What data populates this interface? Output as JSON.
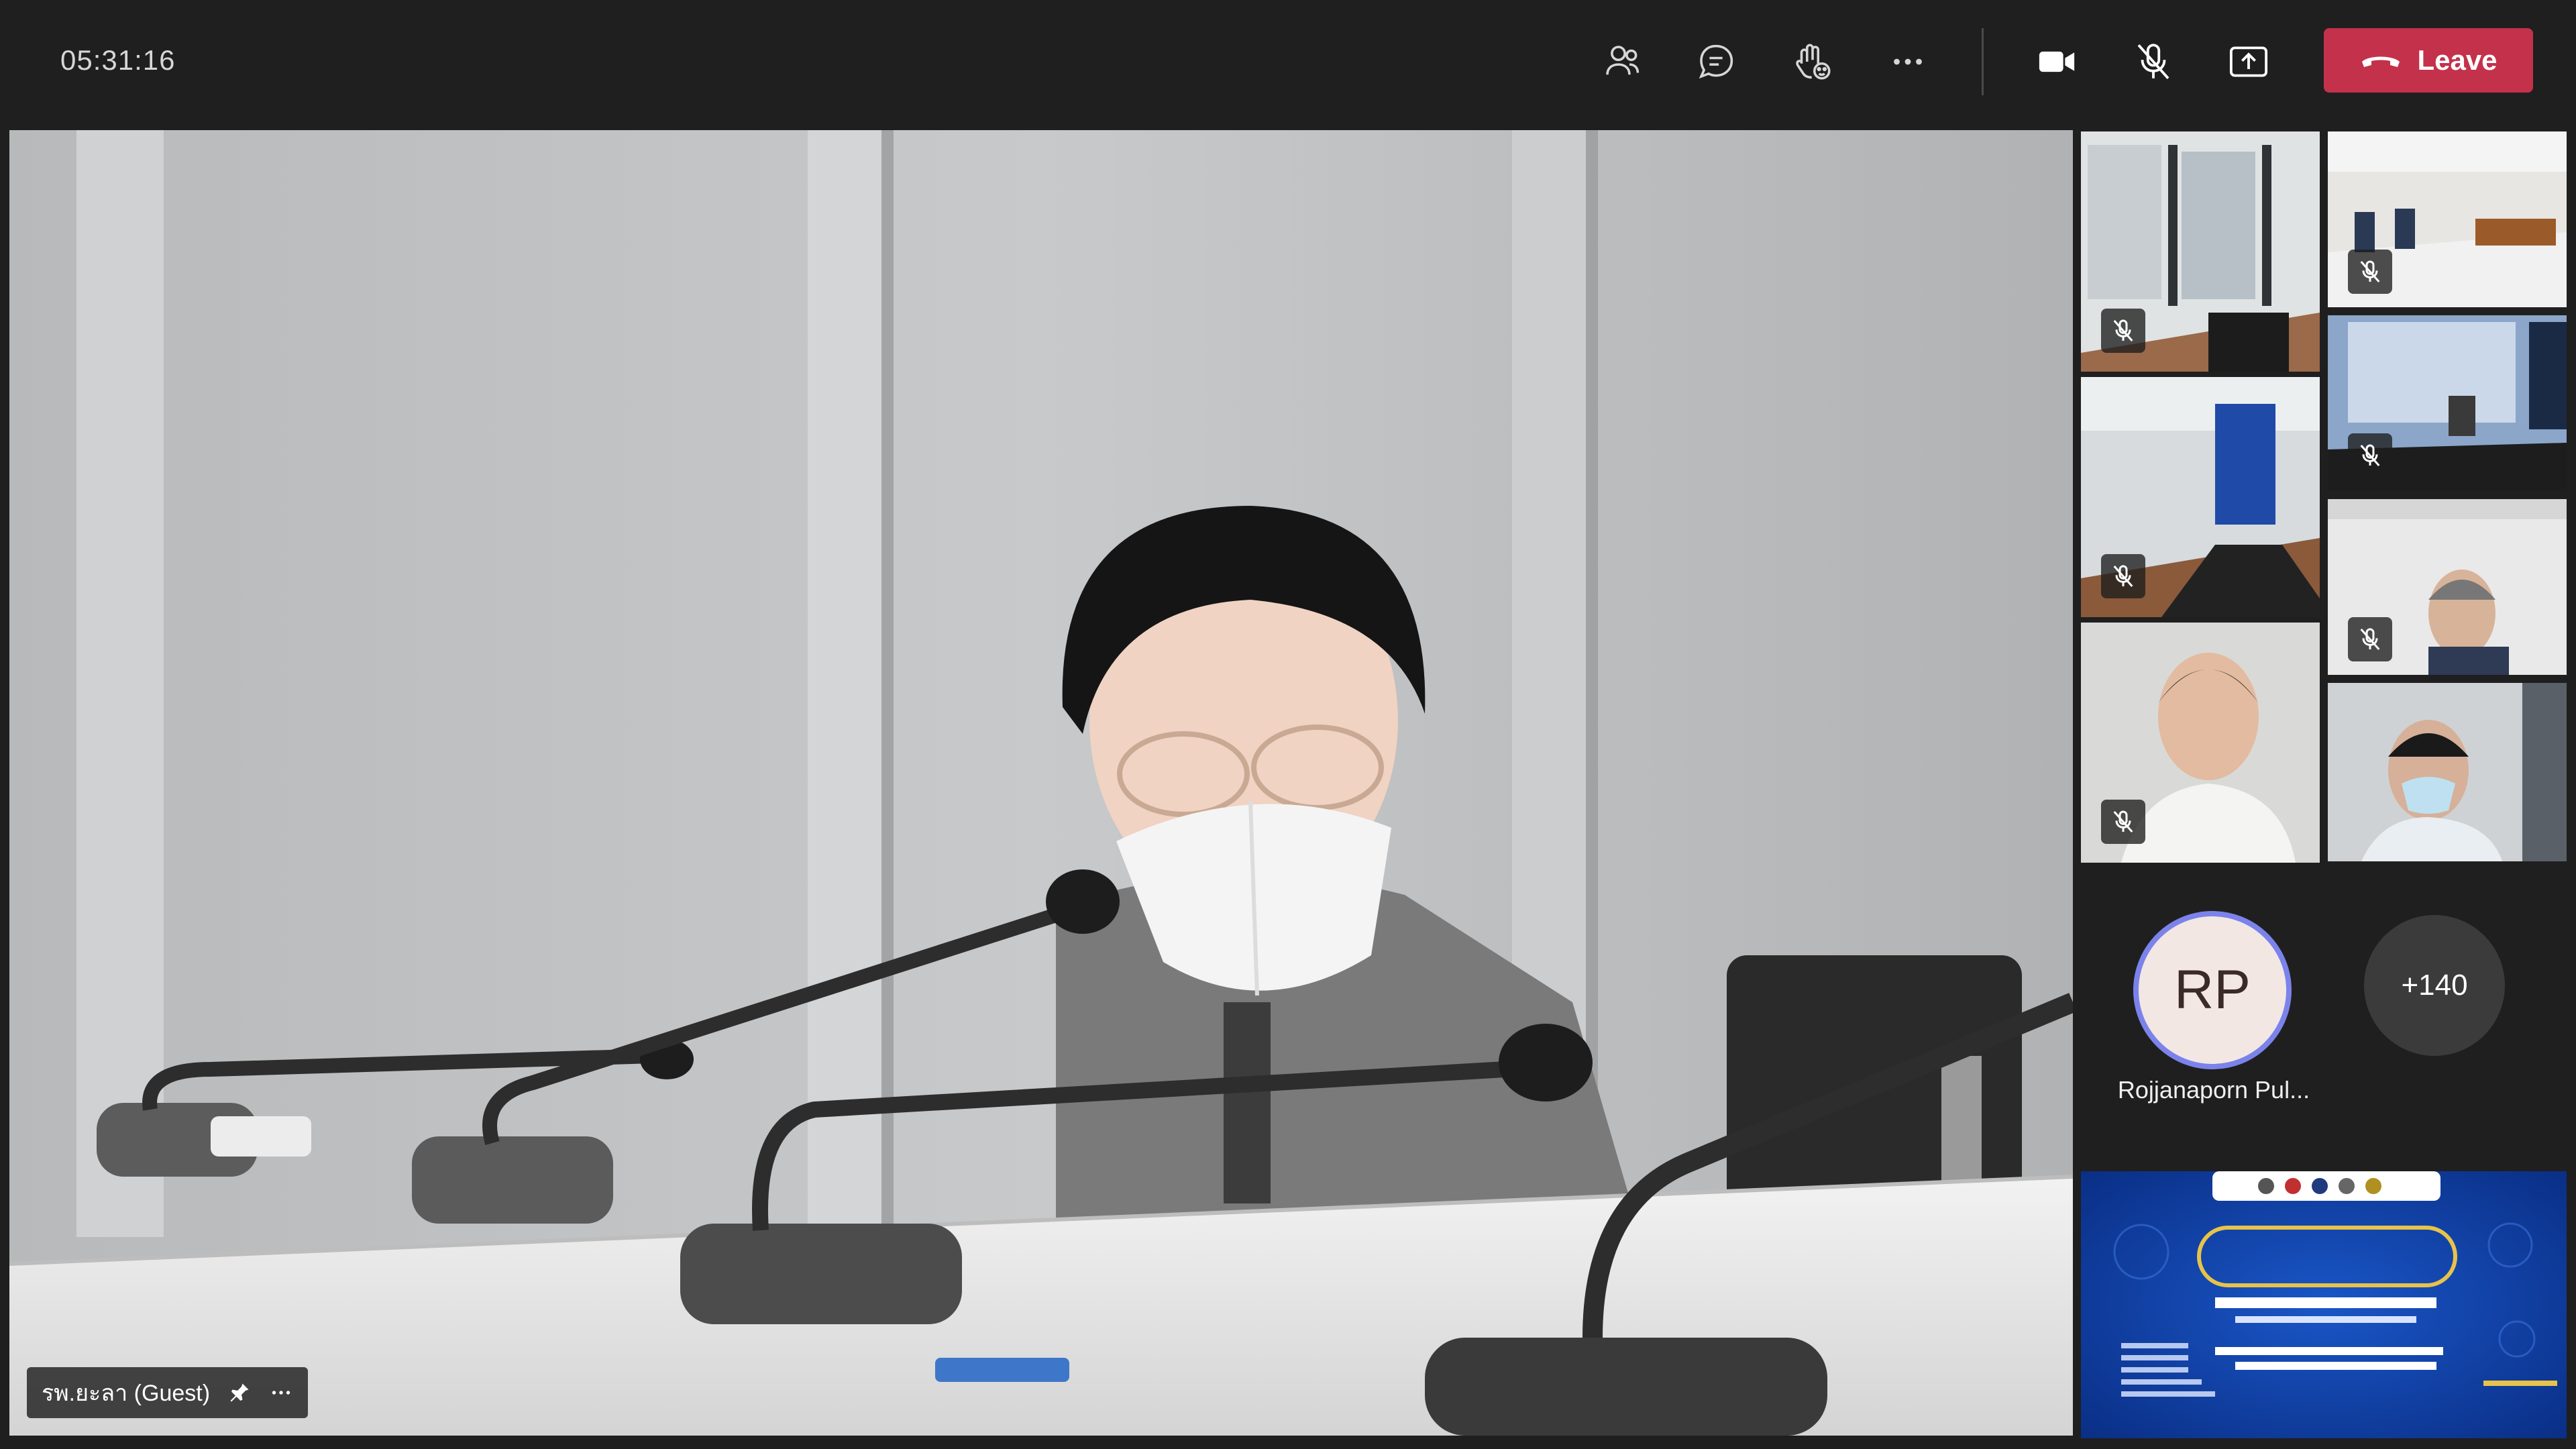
{
  "toolbar": {
    "timer": "05:31:16",
    "leave_label": "Leave",
    "icons": {
      "people": "people-icon",
      "chat": "chat-icon",
      "react": "raise-hand-icon",
      "more": "more-options-icon",
      "camera": "camera-icon",
      "mic": "mic-off-icon",
      "share": "share-screen-icon",
      "phone": "phone-hangup-icon"
    }
  },
  "main_video": {
    "participant_label": "รพ.ยะลา (Guest)",
    "pin_icon": "pin-icon",
    "more_icon": "more-options-icon"
  },
  "gallery": {
    "featured_initials": "RP",
    "featured_name": "Rojjanaporn Pul...",
    "overflow_count": "+140"
  },
  "colors": {
    "background": "#1f1f1f",
    "leave_red": "#c4314b",
    "avatar_ring": "#7b83eb",
    "share_blue": "#0d3ea3"
  }
}
